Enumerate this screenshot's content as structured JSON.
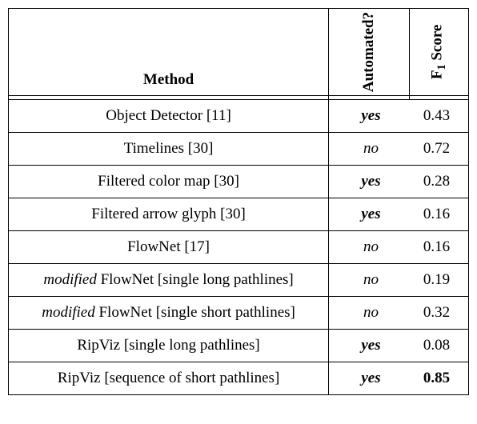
{
  "header": {
    "method": "Method",
    "automated": "Automated?",
    "f1": "F Score",
    "f1_sub": "1"
  },
  "rows": [
    {
      "method": "Object Detector [11]",
      "modified": false,
      "auto": "yes",
      "f1": "0.43",
      "best": false
    },
    {
      "method": "Timelines [30]",
      "modified": false,
      "auto": "no",
      "f1": "0.72",
      "best": false
    },
    {
      "method": "Filtered color map [30]",
      "modified": false,
      "auto": "yes",
      "f1": "0.28",
      "best": false
    },
    {
      "method": "Filtered arrow glyph [30]",
      "modified": false,
      "auto": "yes",
      "f1": "0.16",
      "best": false
    },
    {
      "method": "FlowNet [17]",
      "modified": false,
      "auto": "no",
      "f1": "0.16",
      "best": false
    },
    {
      "method_prefix": "modified",
      "method": " FlowNet [single long pathlines]",
      "modified": true,
      "auto": "no",
      "f1": "0.19",
      "best": false
    },
    {
      "method_prefix": "modified",
      "method": " FlowNet [single short pathlines]",
      "modified": true,
      "auto": "no",
      "f1": "0.32",
      "best": false
    },
    {
      "method": "RipViz [single long pathlines]",
      "modified": false,
      "auto": "yes",
      "f1": "0.08",
      "best": false
    },
    {
      "method": "RipViz [sequence of short pathlines]",
      "modified": false,
      "auto": "yes",
      "f1": "0.85",
      "best": true
    }
  ],
  "chart_data": {
    "type": "table",
    "columns": [
      "Method",
      "Automated?",
      "F1 Score"
    ],
    "rows": [
      [
        "Object Detector [11]",
        "yes",
        0.43
      ],
      [
        "Timelines [30]",
        "no",
        0.72
      ],
      [
        "Filtered color map [30]",
        "yes",
        0.28
      ],
      [
        "Filtered arrow glyph [30]",
        "yes",
        0.16
      ],
      [
        "FlowNet [17]",
        "no",
        0.16
      ],
      [
        "modified FlowNet [single long pathlines]",
        "no",
        0.19
      ],
      [
        "modified FlowNet [single short pathlines]",
        "no",
        0.32
      ],
      [
        "RipViz [single long pathlines]",
        "yes",
        0.08
      ],
      [
        "RipViz [sequence of short pathlines]",
        "yes",
        0.85
      ]
    ]
  }
}
